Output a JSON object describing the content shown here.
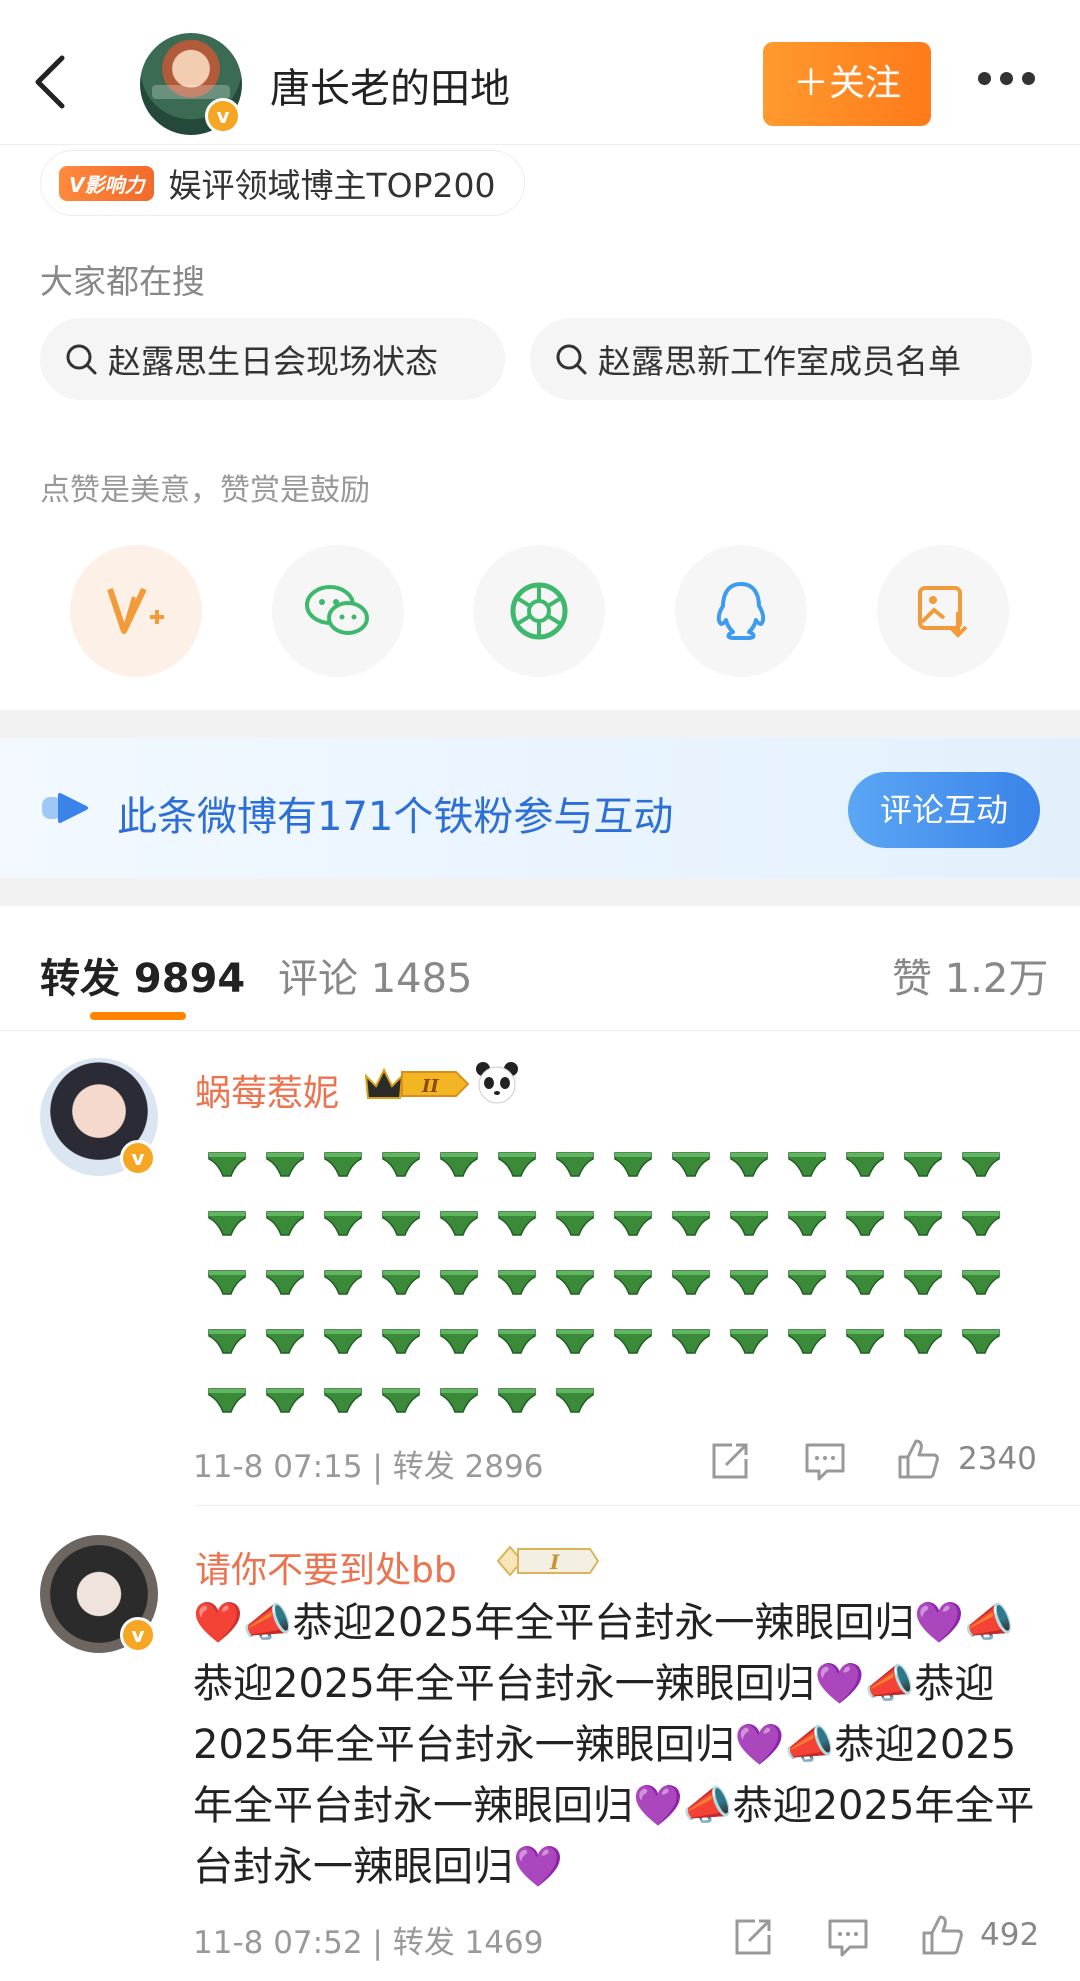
{
  "header": {
    "username": "唐长老的田地",
    "verified_badge": "v",
    "follow_label": "＋关注",
    "icons": [
      "back-arrow-icon",
      "more-dots-icon"
    ]
  },
  "influence": {
    "tag": "V影响力",
    "text": "娱评领域博主TOP200"
  },
  "trending": {
    "heading": "大家都在搜",
    "items": [
      "赵露思生日会现场状态",
      "赵露思新工作室成员名单"
    ]
  },
  "share": {
    "tip": "点赞是美意，赞赏是鼓励",
    "icons": [
      "weibo-v-plus-icon",
      "wechat-icon",
      "moments-icon",
      "qq-icon",
      "save-image-icon"
    ]
  },
  "banner": {
    "text": "此条微博有171个铁粉参与互动",
    "button": "评论互动"
  },
  "tabs": {
    "reposts": "转发 9894",
    "comments": "评论 1485",
    "likes": "赞 1.2万"
  },
  "comments": [
    {
      "user": "蜗莓惹妮",
      "badge_level": "II",
      "emoji_desc": "green-underwear-emoji",
      "emoji_rows": [
        14,
        14,
        14,
        14,
        7
      ],
      "time": "11-8 07:15",
      "repost_label": "转发 2896",
      "likes": "2340"
    },
    {
      "user": "请你不要到处bb",
      "badge_level": "I",
      "text": "❤️📣恭迎2025年全平台封永一辣眼回归💜📣恭迎2025年全平台封永一辣眼回归💜📣恭迎2025年全平台封永一辣眼回归💜📣恭迎2025年全平台封永一辣眼回归💜📣恭迎2025年全平台封永一辣眼回归💜",
      "time": "11-8 07:52",
      "repost_label": "转发 1469",
      "likes": "492"
    }
  ],
  "colors": {
    "accent_orange": "#ff8200",
    "name_orange": "#eb7350",
    "banner_blue": "#2d6fd6",
    "emoji_green": "#3a8a3a"
  }
}
